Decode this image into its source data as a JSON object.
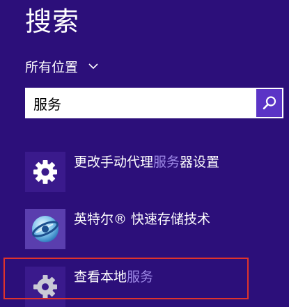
{
  "header": {
    "title": "搜索"
  },
  "scope": {
    "label": "所有位置"
  },
  "search": {
    "value": "服务"
  },
  "results": [
    {
      "prefix": "更改手动代理",
      "match": "服务",
      "suffix": "器设置",
      "icon": "gear-icon"
    },
    {
      "prefix": "英特尔® 快速存储技术",
      "match": "",
      "suffix": "",
      "icon": "intel-rst-icon"
    },
    {
      "prefix": "查看本地",
      "match": "服务",
      "suffix": "",
      "icon": "services-gear-icon"
    }
  ],
  "colors": {
    "background": "#2c0f7a",
    "search_button": "#5b34c6",
    "match_highlight": "#9d88e6",
    "annotation_box": "#e0332b"
  }
}
